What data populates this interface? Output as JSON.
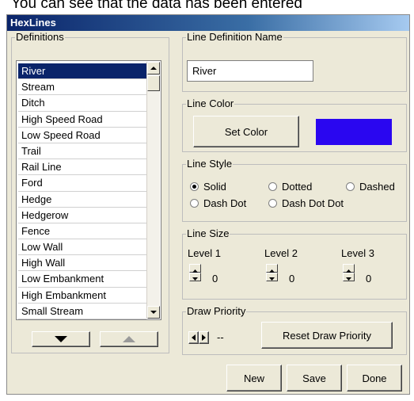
{
  "caption": "You can see that the data has been entered",
  "window": {
    "title": "HexLines"
  },
  "definitions": {
    "legend": "Definitions",
    "items": [
      "River",
      "Stream",
      "Ditch",
      "High Speed Road",
      "Low Speed Road",
      "Trail",
      "Rail Line",
      "Ford",
      "Hedge",
      "Hedgerow",
      "Fence",
      "Low Wall",
      "High Wall",
      "Low Embankment",
      "High Embankment",
      "Small Stream"
    ],
    "selected": "River",
    "move_down_icon": "triangle-down-icon",
    "move_up_icon": "triangle-up-icon"
  },
  "line_definition_name": {
    "legend": "Line Definition Name",
    "value": "River"
  },
  "line_color": {
    "legend": "Line Color",
    "button_label": "Set Color",
    "color": "#2a06f0"
  },
  "line_style": {
    "legend": "Line Style",
    "options": [
      "Solid",
      "Dotted",
      "Dashed",
      "Dash Dot",
      "Dash Dot Dot"
    ],
    "selected": "Solid"
  },
  "line_size": {
    "legend": "Line Size",
    "levels": [
      {
        "label": "Level 1",
        "value": "0"
      },
      {
        "label": "Level 2",
        "value": "0"
      },
      {
        "label": "Level 3",
        "value": "0"
      }
    ]
  },
  "draw_priority": {
    "legend": "Draw Priority",
    "value": "--",
    "reset_label": "Reset Draw Priority"
  },
  "footer": {
    "new_label": "New",
    "save_label": "Save",
    "done_label": "Done"
  }
}
